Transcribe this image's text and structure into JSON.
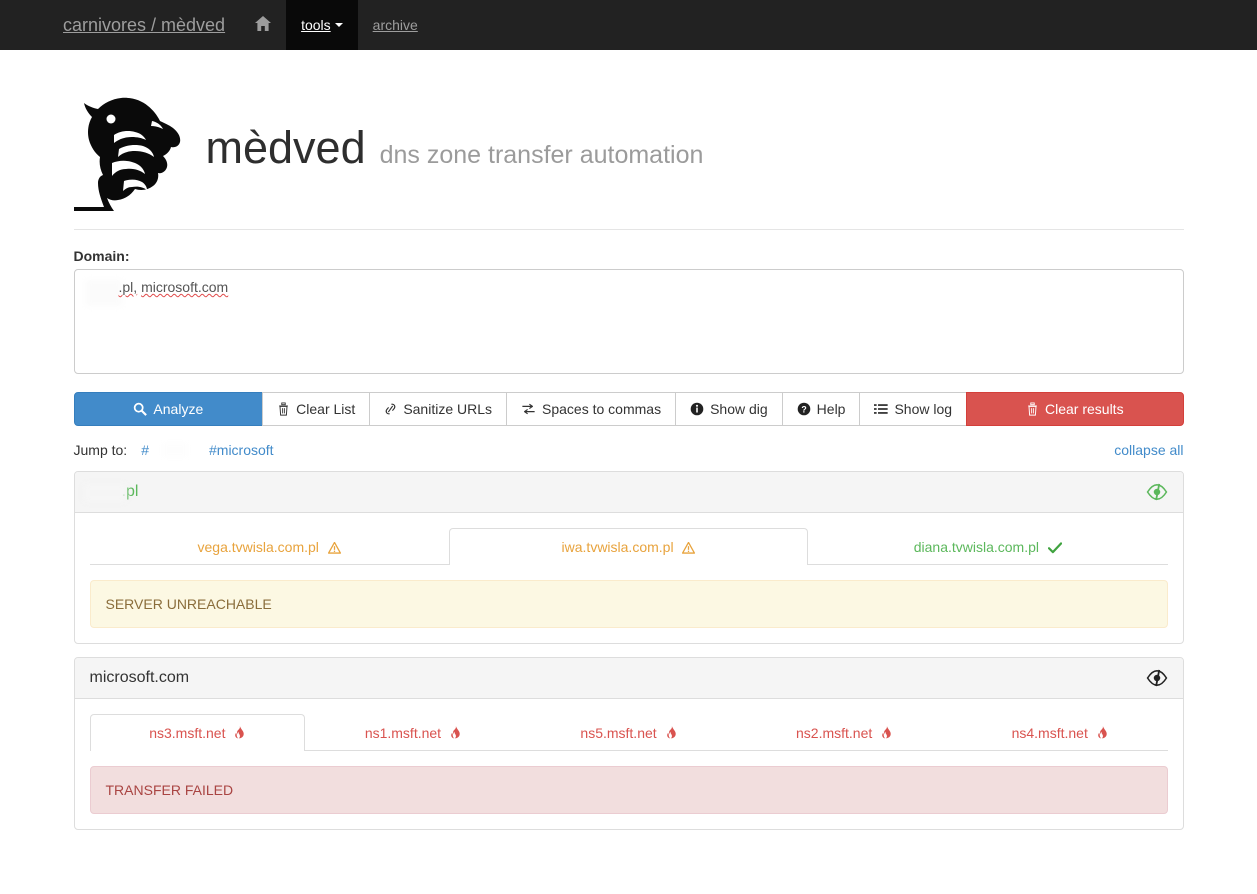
{
  "navbar": {
    "brand": "carnivores / mèdved",
    "home_icon": "home-icon",
    "items": [
      {
        "label": "tools",
        "active": true,
        "has_caret": true
      },
      {
        "label": "archive",
        "active": false,
        "has_caret": false
      }
    ]
  },
  "masthead": {
    "logo_icon": "bear-head-logo",
    "title": "mèdved",
    "subtitle": "dns zone transfer automation"
  },
  "form": {
    "label": "Domain:",
    "value": ".pl, microsoft.com",
    "value_visible_parts": [
      ".pl,",
      "microsoft.com"
    ],
    "redacted_prefix": true
  },
  "toolbar": {
    "buttons": [
      {
        "label": "Analyze",
        "icon": "search-icon",
        "style": "primary"
      },
      {
        "label": "Clear List",
        "icon": "trash-icon",
        "style": "default"
      },
      {
        "label": "Sanitize URLs",
        "icon": "link-icon",
        "style": "default"
      },
      {
        "label": "Spaces to commas",
        "icon": "exchange-icon",
        "style": "default"
      },
      {
        "label": "Show dig",
        "icon": "info-circle-icon",
        "style": "default"
      },
      {
        "label": "Help",
        "icon": "question-circle-icon",
        "style": "default"
      },
      {
        "label": "Show log",
        "icon": "list-icon",
        "style": "default"
      },
      {
        "label": "Clear results",
        "icon": "trash-icon",
        "style": "danger"
      }
    ]
  },
  "jumpbar": {
    "label": "Jump to:",
    "links": [
      {
        "text": "#",
        "redacted": true
      },
      {
        "text": "#microsoft",
        "redacted": false
      }
    ],
    "collapse_all": "collapse all"
  },
  "panels": [
    {
      "title": ".pl",
      "title_color": "#5cb85c",
      "title_redacted": true,
      "eye_icon": "eye-slash-icon",
      "eye_color": "#5cb85c",
      "nameservers": [
        {
          "name": "vega.tvwisla.com.pl",
          "status": "warn",
          "icon": "warning-triangle-icon",
          "active": false
        },
        {
          "name": "iwa.tvwisla.com.pl",
          "status": "warn",
          "icon": "warning-triangle-icon",
          "active": true
        },
        {
          "name": "diana.tvwisla.com.pl",
          "status": "ok",
          "icon": "check-icon",
          "active": false
        }
      ],
      "alert": {
        "text": "SERVER UNREACHABLE",
        "kind": "warning"
      }
    },
    {
      "title": "microsoft.com",
      "title_color": "#333333",
      "title_redacted": false,
      "eye_icon": "eye-slash-icon",
      "eye_color": "#222222",
      "nameservers": [
        {
          "name": "ns3.msft.net",
          "status": "fail",
          "icon": "fire-icon",
          "active": true
        },
        {
          "name": "ns1.msft.net",
          "status": "fail",
          "icon": "fire-icon",
          "active": false
        },
        {
          "name": "ns5.msft.net",
          "status": "fail",
          "icon": "fire-icon",
          "active": false
        },
        {
          "name": "ns2.msft.net",
          "status": "fail",
          "icon": "fire-icon",
          "active": false
        },
        {
          "name": "ns4.msft.net",
          "status": "fail",
          "icon": "fire-icon",
          "active": false
        }
      ],
      "alert": {
        "text": "TRANSFER FAILED",
        "kind": "danger"
      }
    }
  ],
  "colors": {
    "navbar_bg": "#222222",
    "primary": "#428bca",
    "danger": "#d9534f",
    "success": "#5cb85c",
    "warning": "#e8a33d"
  }
}
